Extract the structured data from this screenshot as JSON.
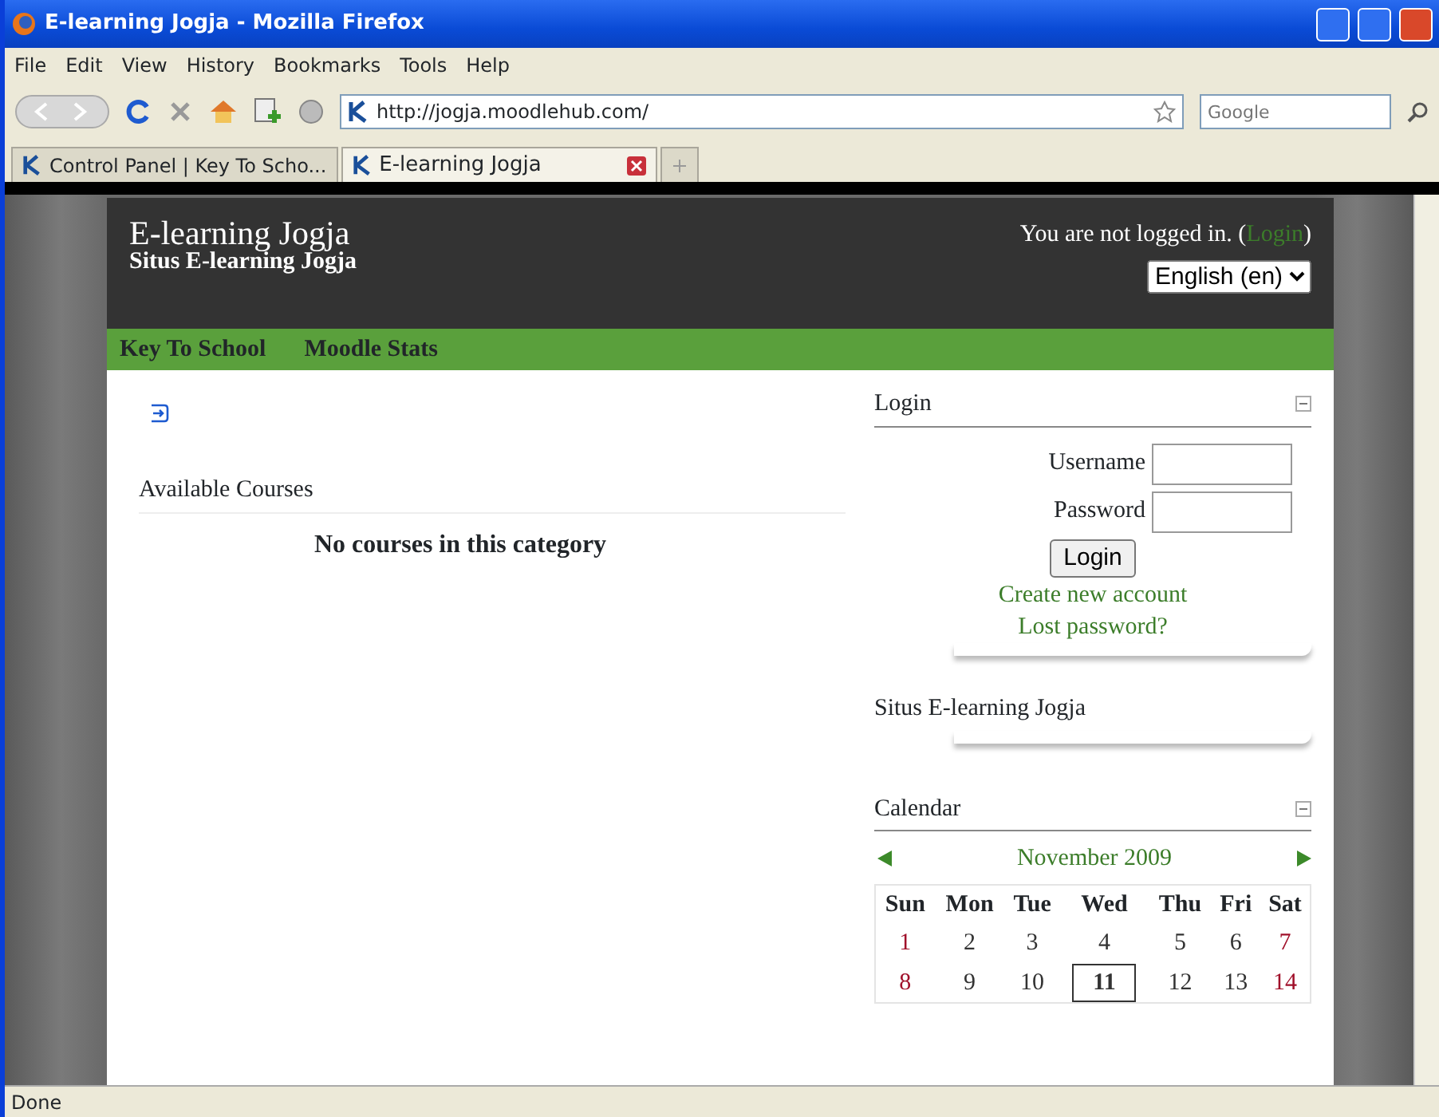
{
  "window": {
    "title": "E-learning Jogja - Mozilla Firefox"
  },
  "menu": [
    "File",
    "Edit",
    "View",
    "History",
    "Bookmarks",
    "Tools",
    "Help"
  ],
  "address": {
    "value": "http://jogja.moodlehub.com/"
  },
  "search": {
    "placeholder": "Google"
  },
  "tabs": [
    {
      "label": "Control Panel | Key To Scho...",
      "selected": false
    },
    {
      "label": "E-learning Jogja",
      "selected": true
    }
  ],
  "header": {
    "title": "E-learning Jogja",
    "subtitle": "Situs E-learning Jogja",
    "login_before": "You are not logged in. (",
    "login_link": "Login",
    "login_after": ")",
    "language": "English (en)"
  },
  "nav": [
    "Key To School",
    "Moodle Stats"
  ],
  "main": {
    "heading": "Available Courses",
    "empty_message": "No courses in this category"
  },
  "login_block": {
    "title": "Login",
    "fields": [
      {
        "label": "Username"
      },
      {
        "label": "Password"
      }
    ],
    "button": "Login",
    "links": [
      "Create new account",
      "Lost password?"
    ]
  },
  "site_block": {
    "title": "Situs E-learning Jogja"
  },
  "calendar": {
    "title": "Calendar",
    "month": "November 2009",
    "weekdays": [
      "Sun",
      "Mon",
      "Tue",
      "Wed",
      "Thu",
      "Fri",
      "Sat"
    ],
    "weeks": [
      [
        {
          "day": "1",
          "weekend": true,
          "today": false
        },
        {
          "day": "2",
          "weekend": false,
          "today": false
        },
        {
          "day": "3",
          "weekend": false,
          "today": false
        },
        {
          "day": "4",
          "weekend": false,
          "today": false
        },
        {
          "day": "5",
          "weekend": false,
          "today": false
        },
        {
          "day": "6",
          "weekend": false,
          "today": false
        },
        {
          "day": "7",
          "weekend": true,
          "today": false
        }
      ],
      [
        {
          "day": "8",
          "weekend": true,
          "today": false
        },
        {
          "day": "9",
          "weekend": false,
          "today": false
        },
        {
          "day": "10",
          "weekend": false,
          "today": false
        },
        {
          "day": "11",
          "weekend": false,
          "today": true
        },
        {
          "day": "12",
          "weekend": false,
          "today": false
        },
        {
          "day": "13",
          "weekend": false,
          "today": false
        },
        {
          "day": "14",
          "weekend": true,
          "today": false
        }
      ]
    ]
  },
  "status_bar": "Done"
}
